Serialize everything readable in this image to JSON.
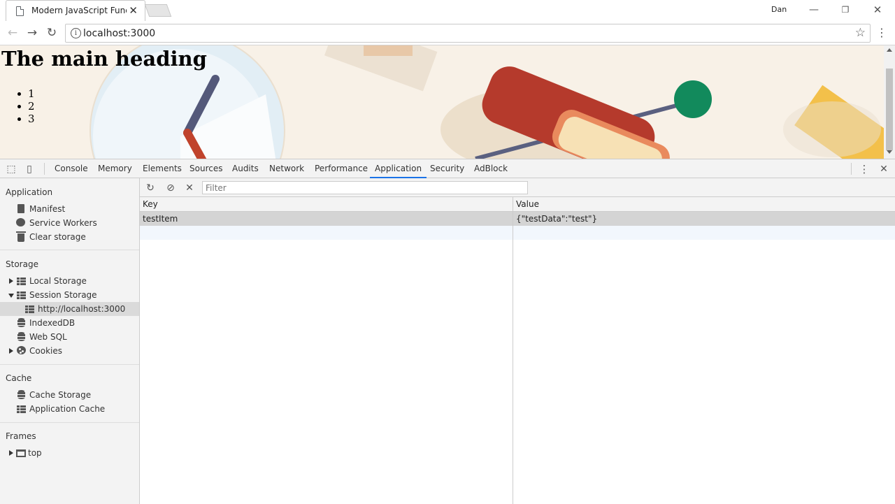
{
  "browser": {
    "tab_title": "Modern JavaScript Funda",
    "user": "Dan",
    "url": "localhost:3000"
  },
  "page": {
    "heading": "The main heading",
    "list": [
      "1",
      "2",
      "3"
    ]
  },
  "devtools": {
    "tabs": [
      "Console",
      "Memory",
      "Elements",
      "Sources",
      "Audits",
      "Network",
      "Performance",
      "Application",
      "Security",
      "AdBlock"
    ],
    "active_tab": "Application",
    "sidebar": {
      "application_title": "Application",
      "application_items": [
        "Manifest",
        "Service Workers",
        "Clear storage"
      ],
      "storage_title": "Storage",
      "storage_items": [
        "Local Storage",
        "Session Storage",
        "http://localhost:3000",
        "IndexedDB",
        "Web SQL",
        "Cookies"
      ],
      "cache_title": "Cache",
      "cache_items": [
        "Cache Storage",
        "Application Cache"
      ],
      "frames_title": "Frames",
      "frames_items": [
        "top"
      ]
    },
    "filter_placeholder": "Filter",
    "table": {
      "columns": [
        "Key",
        "Value"
      ],
      "rows": [
        {
          "key": "testItem",
          "value": "{\"testData\":\"test\"}"
        }
      ]
    }
  }
}
